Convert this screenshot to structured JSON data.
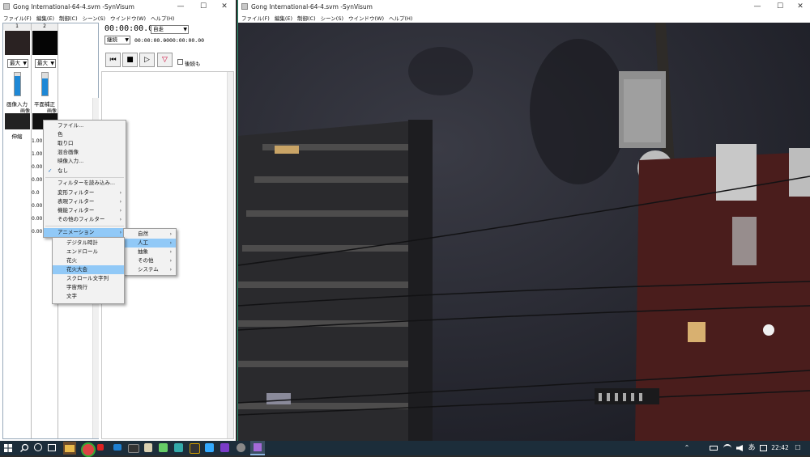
{
  "left_window": {
    "title": "Gong International-64-4.svm -SynVisum",
    "controls": [
      "—",
      "☐",
      "✕"
    ],
    "menu": [
      "ファイル(F)",
      "編集(E)",
      "制御(C)",
      "シーン(S)",
      "ウインドウ(W)",
      "ヘルプ(H)"
    ]
  },
  "right_window": {
    "title": "Gong International-64-4.svm -SynVisum",
    "controls": [
      "—",
      "☐",
      "✕"
    ],
    "menu": [
      "ファイル(F)",
      "編集(E)",
      "制御(C)",
      "シーン(S)",
      "ウインドウ(W)",
      "ヘルプ(H)"
    ]
  },
  "tracks": {
    "headers": [
      "1",
      "2"
    ],
    "size_select": [
      "最大",
      "最大"
    ],
    "level_a": 0.85,
    "level_b": 0.75,
    "labels": [
      "画像入力",
      "平面補正"
    ],
    "sublabels": [
      "画像",
      "画像"
    ],
    "bottom_label": "伸縮"
  },
  "values": [
    "1.00",
    "1.00",
    "0.00",
    "0.00",
    "0.0",
    "0.00",
    "0.00",
    "0.00"
  ],
  "transport": {
    "time": "00:00:00.00",
    "mode": "自走",
    "loop": "継続",
    "range_start": "00:00:00.00",
    "range_sep": "-",
    "range_end": "00:00:00.00",
    "buttons": [
      "⏮",
      "■",
      "▷",
      "▽"
    ],
    "continue_label": "後続も"
  },
  "context_menu": {
    "items": [
      "ファイル...",
      "色",
      "取り口",
      "混合画像",
      "映像入力...",
      "なし",
      "フィルターを読み込み...",
      "変形フィルター",
      "表現フィルター",
      "機能フィルター",
      "その他のフィルター",
      "アニメーション"
    ],
    "checked_marker": "✓"
  },
  "submenu_anim": {
    "items": [
      "自然",
      "人工",
      "抽象",
      "その他",
      "システム"
    ]
  },
  "submenu_artificial": {
    "items": [
      "デジタル時計",
      "エンドロール",
      "花火",
      "花火大会",
      "スクロール文字列",
      "宇宙飛行",
      "文字"
    ]
  },
  "taskbar": {
    "ime": "あ",
    "time": "22:42",
    "chevron": "⌃",
    "notification_icon": "☐"
  },
  "colors": {
    "highlight": "#91c9f7",
    "slider": "#1e88d6",
    "taskbar": "#1c2d3a"
  }
}
